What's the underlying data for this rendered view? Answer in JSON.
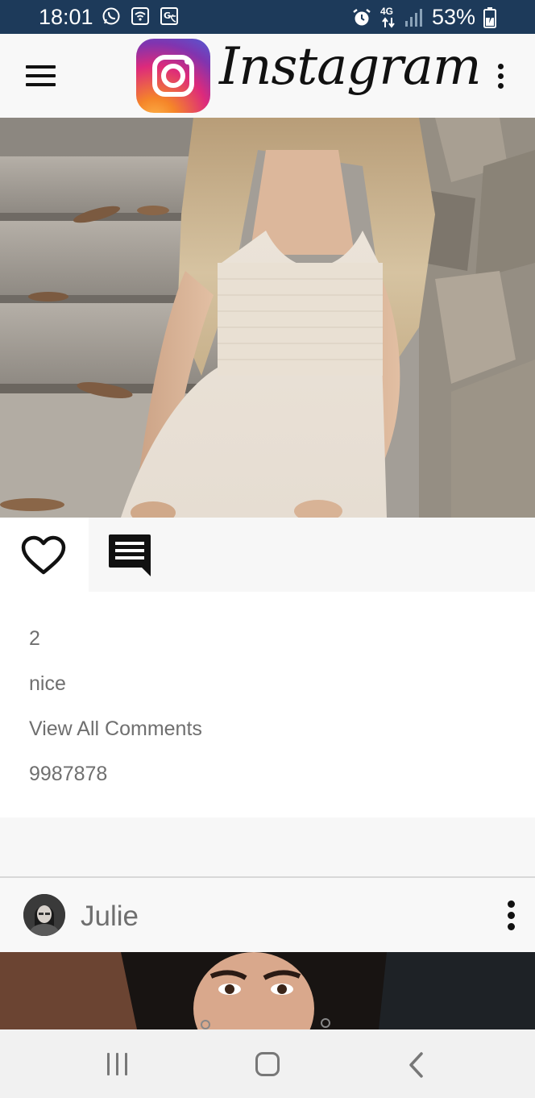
{
  "status_bar": {
    "time": "18:01",
    "network": "4G",
    "battery": "53%",
    "left_icons": [
      "whatsapp-icon",
      "wifi-calling-icon",
      "translate-icon"
    ],
    "right_icons": [
      "alarm-icon",
      "network-4g-icon",
      "signal-icon",
      "battery-charging-icon"
    ]
  },
  "app_bar": {
    "title": "Instagram",
    "menu_icon": "hamburger-menu-icon",
    "overflow_icon": "more-vert-icon"
  },
  "post": {
    "image": "photo-woman-white-dress-on-stairs",
    "like_icon": "heart-outline-icon",
    "comment_icon": "comment-icon",
    "likes": "2",
    "caption": "nice",
    "view_comments": "View All Comments",
    "extra": "9987878"
  },
  "post2": {
    "username": "Julie",
    "avatar": "avatar-julie",
    "image": "photo-woman-dark-hair",
    "overflow_icon": "more-vert-icon"
  },
  "nav_bar": {
    "recent_icon": "recent-apps-icon",
    "home_icon": "home-icon",
    "back_icon": "back-icon"
  },
  "colors": {
    "status_bar": "#1d3a5a",
    "background": "#f7f7f7",
    "text": "#6f6f6f",
    "logo_gradient": [
      "#fdb54a",
      "#f58529",
      "#dd2a7b",
      "#8134af",
      "#515bd4"
    ]
  }
}
